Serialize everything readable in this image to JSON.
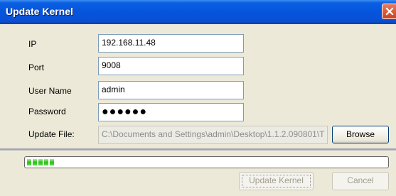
{
  "window": {
    "title": "Update Kernel"
  },
  "form": {
    "ip_label": "IP",
    "ip_value": "192.168.11.48",
    "port_label": "Port",
    "port_value": "9008",
    "username_label": "User Name",
    "username_value": "admin",
    "password_label": "Password",
    "password_mask": "●●●●●●",
    "update_file_label": "Update File:",
    "update_file_value": "C:\\Documents and Settings\\admin\\Desktop\\1.1.2.090801\\T",
    "browse_label": "Browse"
  },
  "progress": {
    "fraction": 0.08
  },
  "buttons": {
    "update_label": "Update Kernel",
    "cancel_label": "Cancel"
  }
}
